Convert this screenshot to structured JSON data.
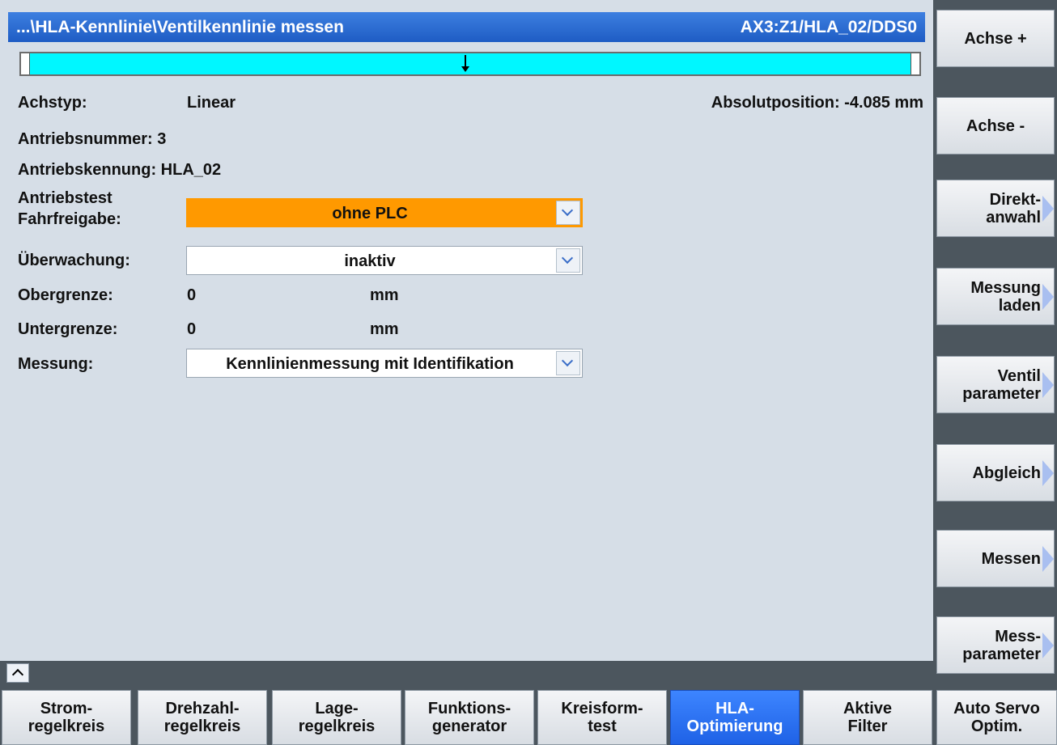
{
  "titlebar": {
    "path": "...\\HLA-Kennlinie\\Ventilkennlinie messen",
    "axis": "AX3:Z1/HLA_02/DDS0"
  },
  "progress": {
    "marker_fraction": 0.495
  },
  "fields": {
    "achstyp_label": "Achstyp:",
    "achstyp_value": "Linear",
    "absolutposition_label": "Absolutposition: -4.085  mm",
    "antriebsnummer_label": "Antriebsnummer: 3",
    "antriebskennung_label": "Antriebskennung: HLA_02",
    "antriebstest_label_1": "Antriebstest",
    "antriebstest_label_2": "Fahrfreigabe:",
    "antriebstest_value": "ohne PLC",
    "ueberwachung_label": "Überwachung:",
    "ueberwachung_value": "inaktiv",
    "obergrenze_label": "Obergrenze:",
    "obergrenze_value": "0",
    "obergrenze_unit": "mm",
    "untergrenze_label": "Untergrenze:",
    "untergrenze_value": "0",
    "untergrenze_unit": "mm",
    "messung_label": "Messung:",
    "messung_value": "Kennlinienmessung mit Identifikation"
  },
  "vertical_softkeys": [
    "Achse +",
    "Achse -",
    "Direkt-\nanwahl",
    "Messung\nladen",
    "Ventil\nparameter",
    "Abgleich",
    "Messen",
    "Mess-\nparameter"
  ],
  "horizontal_softkeys": [
    "Strom-\nregelkreis",
    "Drehzahl-\nregelkreis",
    "Lage-\nregelkreis",
    "Funktions-\ngenerator",
    "Kreisform-\ntest",
    "HLA-\nOptimierung",
    "Aktive\nFilter",
    "Auto Servo\nOptim."
  ],
  "colors": {
    "title": "#1e5cc4",
    "progress": "#00f7ff",
    "orange": "#ff9900",
    "active": "#1f62e6"
  }
}
